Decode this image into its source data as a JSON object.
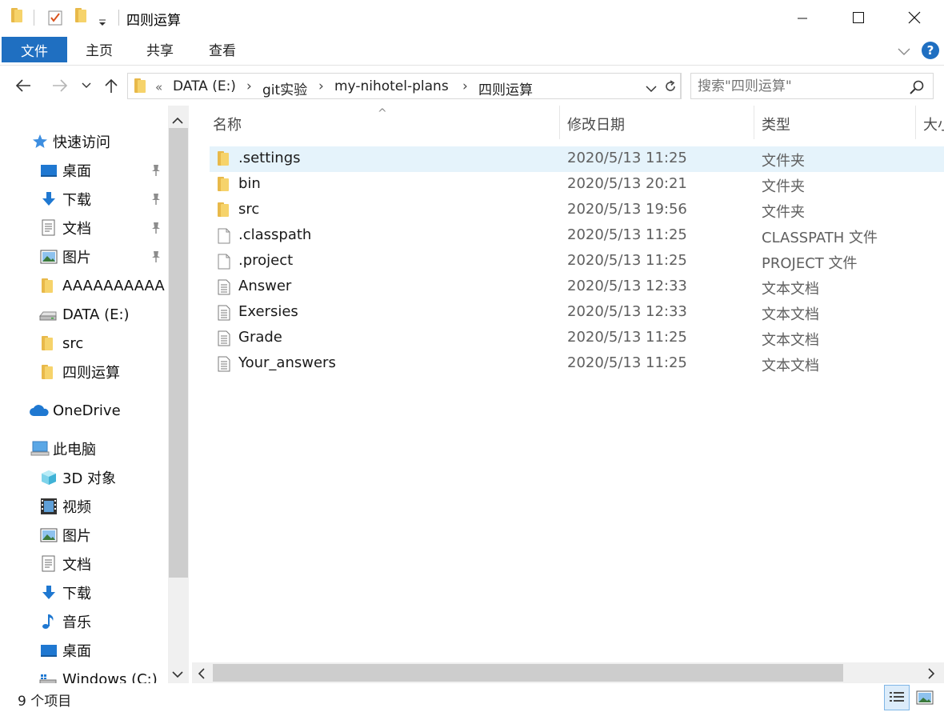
{
  "window": {
    "title": "四则运算",
    "minimize_glyph": "—",
    "maximize_glyph": "☐",
    "close_glyph": "✕"
  },
  "ribbon": {
    "tabs": [
      {
        "label": "文件",
        "active": true
      },
      {
        "label": "主页"
      },
      {
        "label": "共享"
      },
      {
        "label": "查看"
      }
    ],
    "help_glyph": "?"
  },
  "address": {
    "overflow_glyph": "«",
    "crumbs": [
      "DATA (E:)",
      "git实验",
      "my-nihotel-plans",
      "四则运算"
    ],
    "separator": "›"
  },
  "search": {
    "placeholder": "搜索\"四则运算\""
  },
  "nav_pane": {
    "quick_access": {
      "label": "快速访问",
      "items": [
        {
          "label": "桌面",
          "icon": "desktop-icon",
          "pinned": true
        },
        {
          "label": "下载",
          "icon": "download-icon",
          "pinned": true
        },
        {
          "label": "文档",
          "icon": "document-icon",
          "pinned": true
        },
        {
          "label": "图片",
          "icon": "picture-icon",
          "pinned": true
        },
        {
          "label": "AAAAAAAAAA",
          "icon": "folder-icon"
        },
        {
          "label": "DATA (E:)",
          "icon": "drive-icon"
        },
        {
          "label": "src",
          "icon": "folder-icon"
        },
        {
          "label": "四则运算",
          "icon": "folder-icon"
        }
      ]
    },
    "onedrive": {
      "label": "OneDrive"
    },
    "this_pc": {
      "label": "此电脑",
      "items": [
        {
          "label": "3D 对象",
          "icon": "3d-objects-icon"
        },
        {
          "label": "视频",
          "icon": "video-icon"
        },
        {
          "label": "图片",
          "icon": "picture-icon"
        },
        {
          "label": "文档",
          "icon": "document-icon"
        },
        {
          "label": "下载",
          "icon": "download-icon"
        },
        {
          "label": "音乐",
          "icon": "music-icon"
        },
        {
          "label": "桌面",
          "icon": "desktop-icon"
        },
        {
          "label": "Windows (C:)",
          "icon": "windows-drive-icon"
        }
      ]
    }
  },
  "file_list": {
    "columns": [
      "名称",
      "修改日期",
      "类型",
      "大小"
    ],
    "sort_glyph": "^",
    "rows": [
      {
        "name": ".settings",
        "date": "2020/5/13 11:25",
        "type": "文件夹",
        "icon": "folder-icon",
        "selected": true
      },
      {
        "name": "bin",
        "date": "2020/5/13 20:21",
        "type": "文件夹",
        "icon": "folder-icon"
      },
      {
        "name": "src",
        "date": "2020/5/13 19:56",
        "type": "文件夹",
        "icon": "folder-icon"
      },
      {
        "name": ".classpath",
        "date": "2020/5/13 11:25",
        "type": "CLASSPATH 文件",
        "icon": "file-icon"
      },
      {
        "name": ".project",
        "date": "2020/5/13 11:25",
        "type": "PROJECT 文件",
        "icon": "file-icon"
      },
      {
        "name": "Answer",
        "date": "2020/5/13 12:33",
        "type": "文本文档",
        "icon": "text-file-icon"
      },
      {
        "name": "Exersies",
        "date": "2020/5/13 12:33",
        "type": "文本文档",
        "icon": "text-file-icon"
      },
      {
        "name": "Grade",
        "date": "2020/5/13 11:25",
        "type": "文本文档",
        "icon": "text-file-icon"
      },
      {
        "name": "Your_answers",
        "date": "2020/5/13 11:25",
        "type": "文本文档",
        "icon": "text-file-icon"
      }
    ]
  },
  "status": {
    "item_count": "9 个项目"
  },
  "colors": {
    "accent": "#1f6fc1",
    "selection": "#e5f3fb",
    "folder": "#f6d36b",
    "help": "#1f6fc1"
  }
}
